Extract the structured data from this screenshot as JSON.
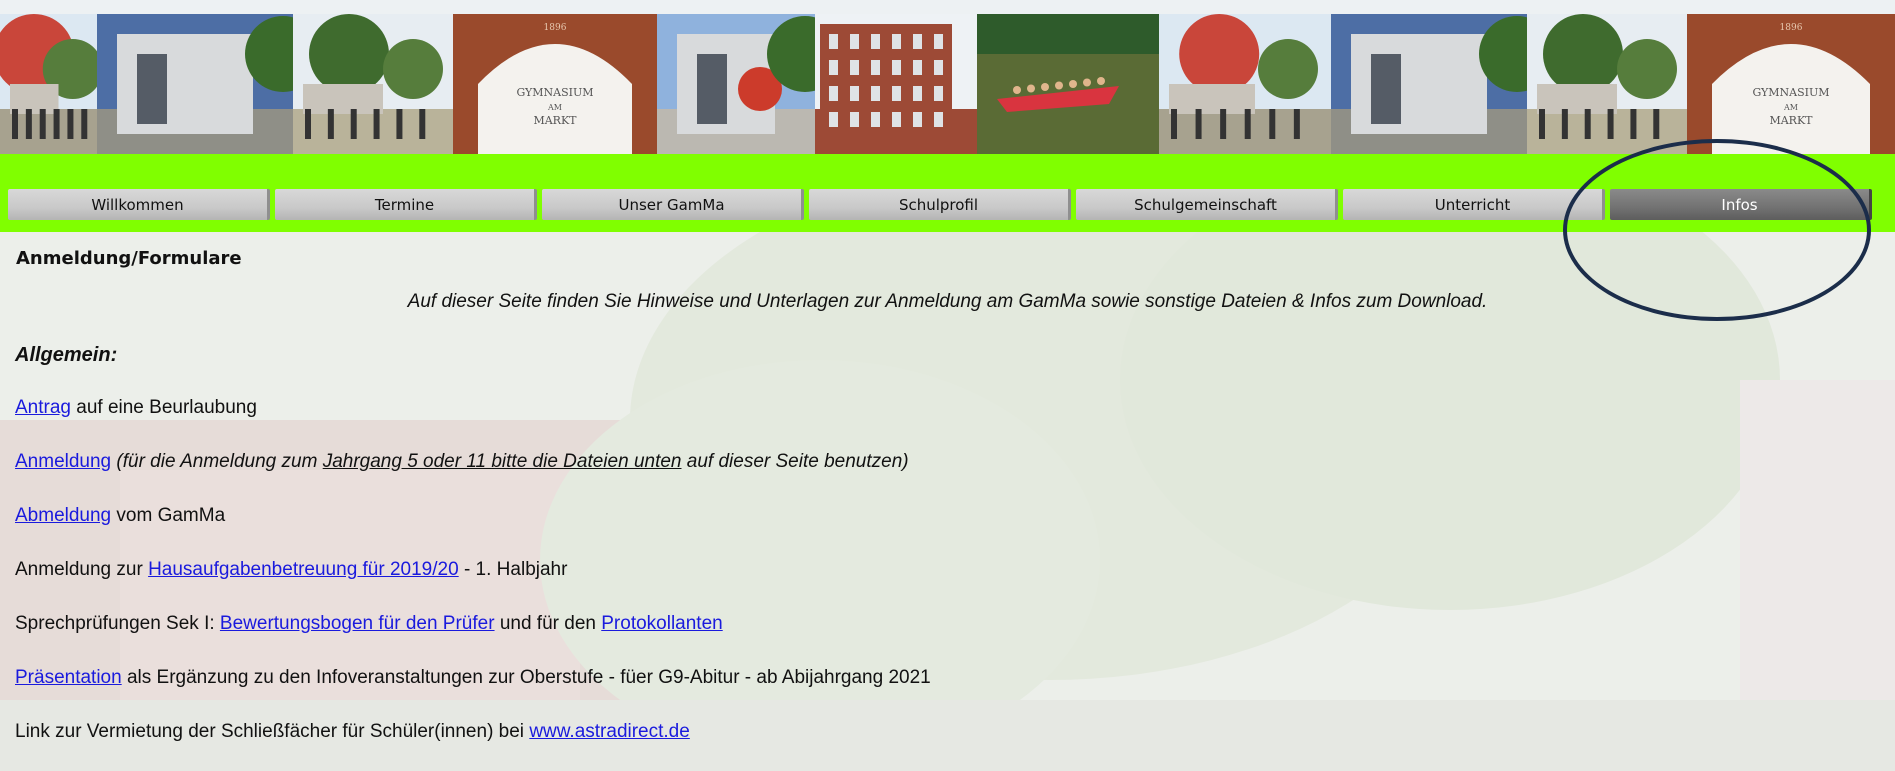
{
  "banner": {
    "tiles": [
      {
        "name": "photo-students-courtyard",
        "sky": "#dce8f2",
        "ground": "#a7a28f",
        "accent": "#c9463a"
      },
      {
        "name": "photo-modern-building",
        "sky": "#4d6ea5",
        "ground": "#8f8f87",
        "accent": "#d8d9da"
      },
      {
        "name": "photo-trees-students",
        "sky": "#e7edf2",
        "ground": "#b9b39a",
        "accent": "#3f6b2e"
      },
      {
        "name": "photo-school-arch",
        "sky": "#f2f0eb",
        "ground": "#9a4a2c",
        "accent": "#ffffff"
      },
      {
        "name": "photo-building-round-window",
        "sky": "#8fb2dd",
        "ground": "#bbb8b1",
        "accent": "#cc3b2b"
      },
      {
        "name": "photo-brick-building",
        "sky": "#eef2f5",
        "ground": "#9d4a36",
        "accent": "#dfe3e6"
      },
      {
        "name": "photo-rowing-boat",
        "sky": "#2e5b2b",
        "ground": "#6b7a43",
        "accent": "#d9343f"
      },
      {
        "name": "photo-students-courtyard-2",
        "sky": "#dce8f2",
        "ground": "#a7a28f",
        "accent": "#c9463a"
      },
      {
        "name": "photo-modern-building-2",
        "sky": "#4d6ea5",
        "ground": "#8f8f87",
        "accent": "#d8d9da"
      },
      {
        "name": "photo-trees-students-2",
        "sky": "#e7edf2",
        "ground": "#b9b39a",
        "accent": "#3f6b2e"
      },
      {
        "name": "photo-school-arch-2",
        "sky": "#f2f0eb",
        "ground": "#9a4a2c",
        "accent": "#ffffff"
      }
    ],
    "arch_text": [
      "GYMNASIUM",
      "AM",
      "MARKT"
    ],
    "arch_year": "1896"
  },
  "nav": {
    "items": [
      {
        "label": "Willkommen",
        "active": false
      },
      {
        "label": "Termine",
        "active": false
      },
      {
        "label": "Unser GamMa",
        "active": false
      },
      {
        "label": "Schulprofil",
        "active": false
      },
      {
        "label": "Schulgemeinschaft",
        "active": false
      },
      {
        "label": "Unterricht",
        "active": false
      },
      {
        "label": "Infos",
        "active": true
      }
    ],
    "bar_color": "#80ff00"
  },
  "content": {
    "heading": "Anmeldung/Formulare",
    "intro": "Auf dieser Seite finden Sie Hinweise und Unterlagen zur Anmeldung am GamMa sowie sonstige Dateien & Infos zum Download.",
    "section_title": "Allgemein:",
    "lines": {
      "antrag": {
        "link": "Antrag",
        "text": " auf eine Beurlaubung"
      },
      "anmeldung": {
        "link": "Anmeldung",
        "note_pre": " (für die Anmeldung zum ",
        "note_underlined": "Jahrgang 5 oder 11 bitte die Dateien unten",
        "note_post": " auf dieser Seite benutzen)"
      },
      "abmeldung": {
        "link": "Abmeldung",
        "text": " vom GamMa"
      },
      "hausaufgaben": {
        "pre": "Anmeldung zur ",
        "link": "Hausaufgabenbetreuung für 2019/20",
        "post": " - 1. Halbjahr"
      },
      "sprech": {
        "pre": "Sprechprüfungen Sek I: ",
        "link1": "Bewertungsbogen für den Prüfer",
        "mid": " und für den ",
        "link2": "Protokollanten"
      },
      "praesentation": {
        "link": "Präsentation",
        "text": " als Ergänzung zu den Infoveranstaltungen zur Oberstufe - füer G9-Abitur - ab Abijahrgang 2021"
      },
      "schliessfach": {
        "pre": "Link zur Vermietung der Schließfächer für Schüler(innen) bei ",
        "link": "www.astradirect.de"
      }
    }
  },
  "colors": {
    "link": "#1a1add",
    "highlight_ellipse": "#1b2d4a"
  }
}
